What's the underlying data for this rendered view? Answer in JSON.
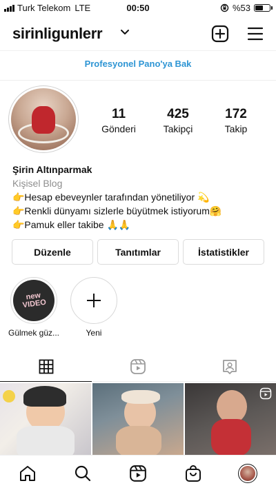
{
  "status_bar": {
    "carrier": "Turk Telekom",
    "network": "LTE",
    "time": "00:50",
    "orientation_lock_icon": "lock-rotation-icon",
    "battery_text": "%53",
    "battery_level": 0.53
  },
  "header": {
    "username": "sirinligunlerr",
    "icons": [
      "chevron-down-icon",
      "add-post-icon",
      "menu-icon"
    ]
  },
  "dashboard_link": "Profesyonel Pano'ya Bak",
  "profile": {
    "stats": [
      {
        "count": "11",
        "label": "Gönderi"
      },
      {
        "count": "425",
        "label": "Takipçi"
      },
      {
        "count": "172",
        "label": "Takip"
      }
    ],
    "name": "Şirin Altınparmak",
    "category": "Kişisel Blog",
    "bio_lines": [
      "👉Hesap ebeveynler tarafından yönetiliyor 💫",
      "👉Renkli dünyamı sizlerle büyütmek istiyorum🤗",
      "👉Pamuk eller takibe 🙏🙏"
    ]
  },
  "buttons": {
    "edit": "Düzenle",
    "promotions": "Tanıtımlar",
    "insights": "İstatistikler"
  },
  "highlights": [
    {
      "title": "Gülmek güz...",
      "cover_text": "new\nVIDEO"
    },
    {
      "title": "Yeni"
    }
  ],
  "tabs": [
    "grid-icon",
    "reels-icon",
    "tagged-icon"
  ],
  "bottom_nav": [
    "home-icon",
    "search-icon",
    "reels-icon",
    "shop-icon",
    "profile-avatar"
  ],
  "colors": {
    "link_blue": "#2e95d4",
    "border": "#dbdbdb",
    "muted_text": "#8e8e8e"
  }
}
